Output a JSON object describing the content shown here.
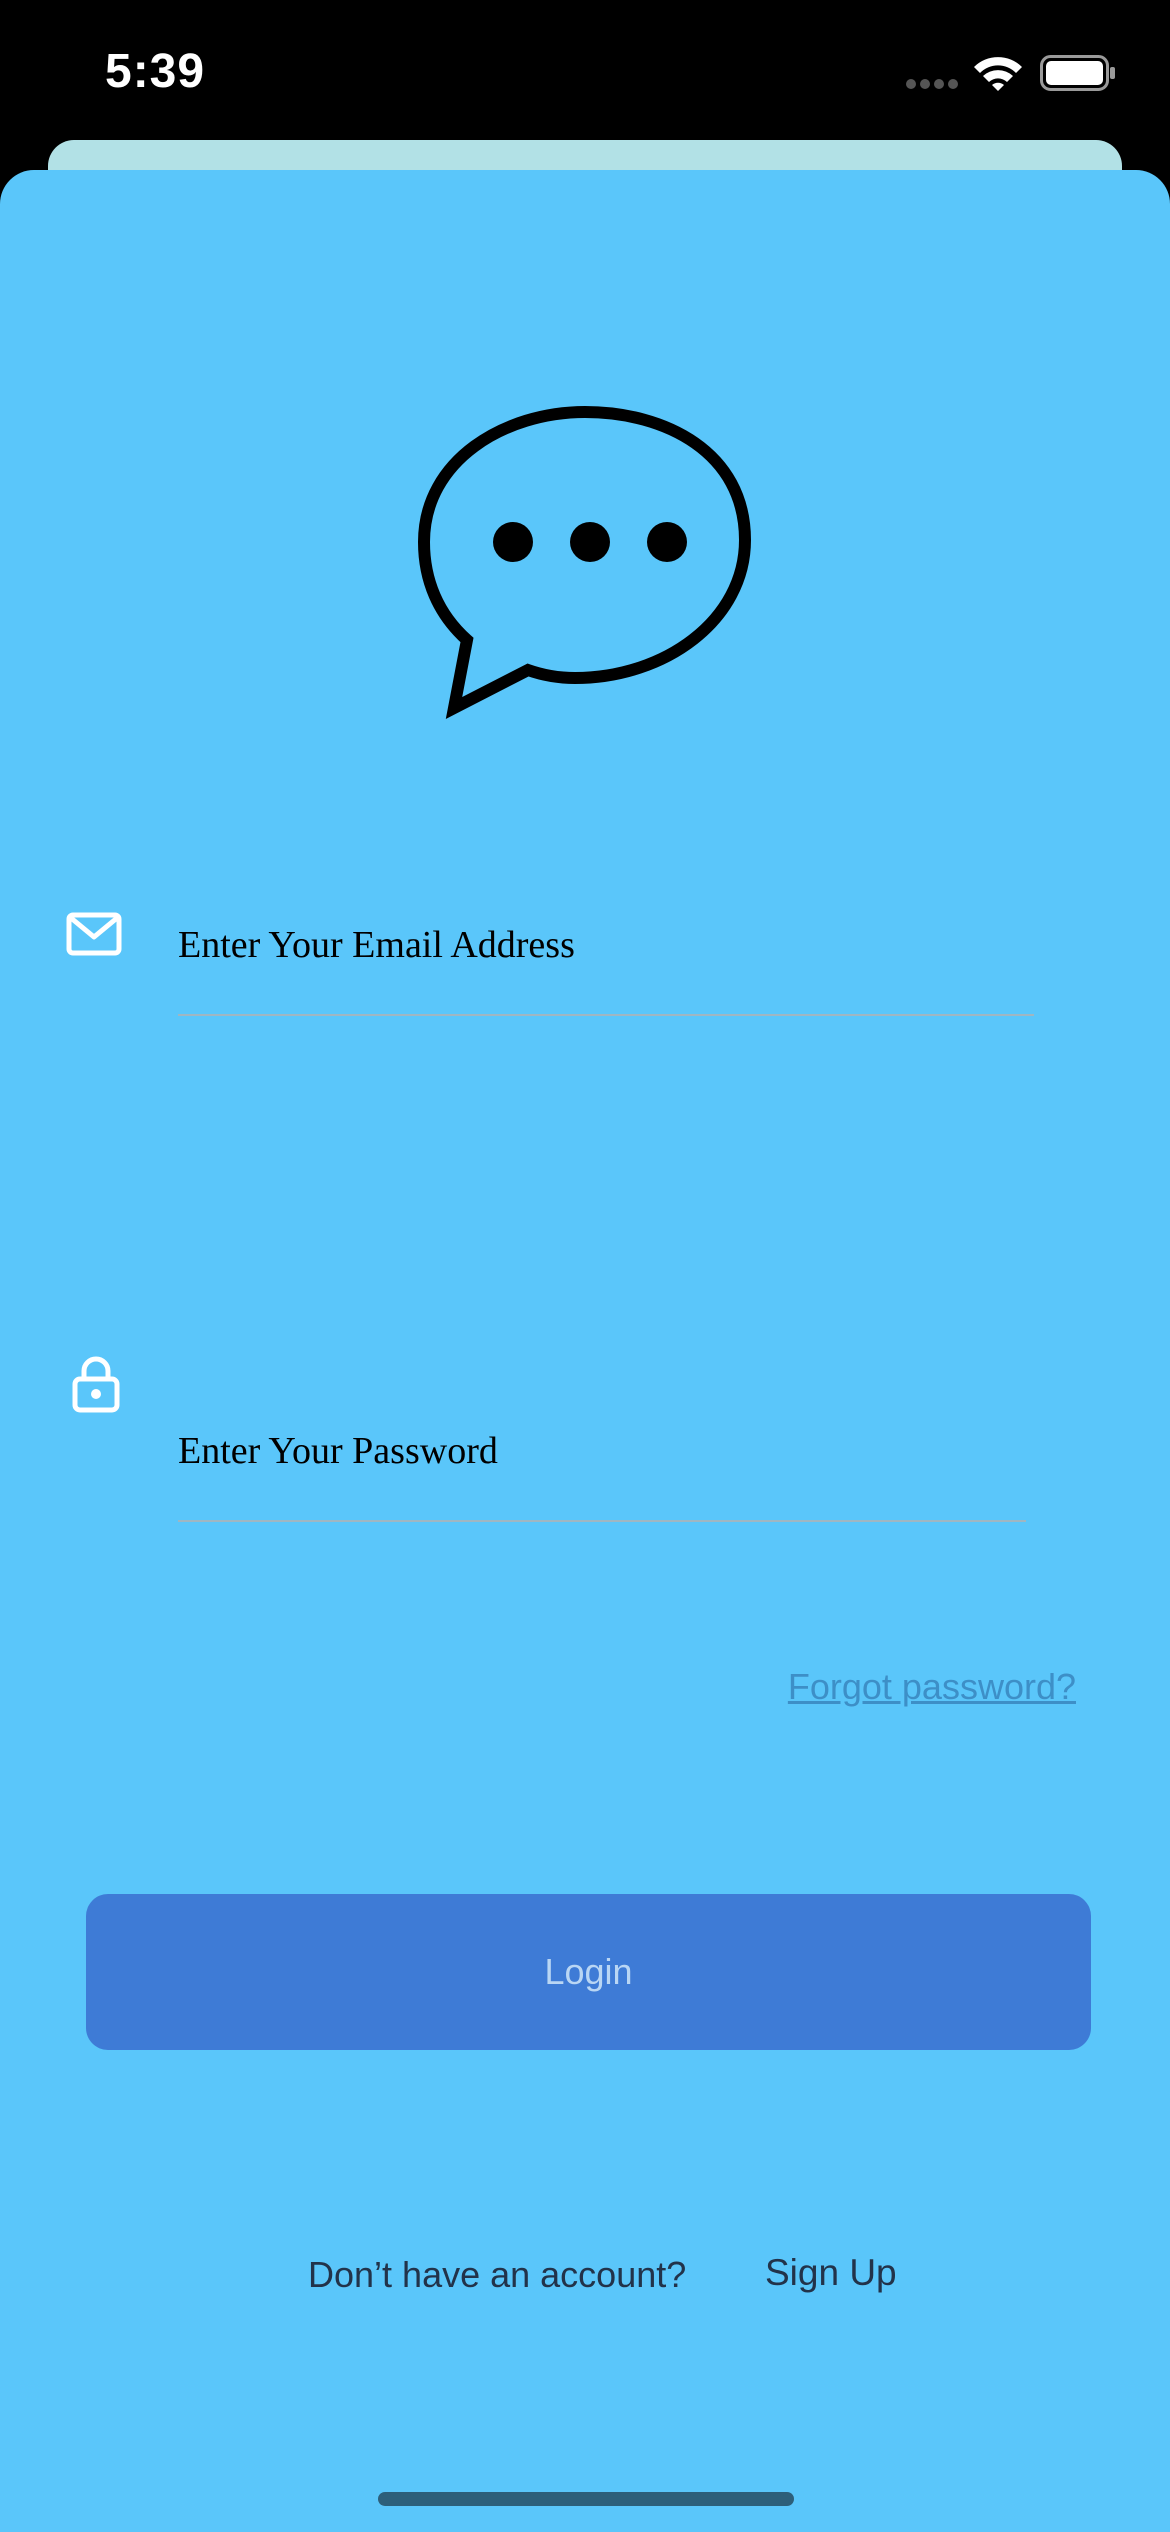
{
  "status_bar": {
    "time": "5:39"
  },
  "logo": {
    "icon": "chat-bubble-ellipsis-icon"
  },
  "email": {
    "icon": "mail-icon",
    "placeholder": "Enter Your Email Address",
    "value": ""
  },
  "password": {
    "icon": "lock-icon",
    "placeholder": "Enter Your Password",
    "value": ""
  },
  "forgot_password": {
    "label": "Forgot password?"
  },
  "login": {
    "label": "Login"
  },
  "signup": {
    "prompt": "Don’t have an account?",
    "link": "Sign Up"
  },
  "colors": {
    "background": "#5ac6fa",
    "button": "#3e7bd6",
    "button_text": "#b9d6f4",
    "link": "#3d8fc7",
    "back_sheet": "#b2e1e6"
  }
}
